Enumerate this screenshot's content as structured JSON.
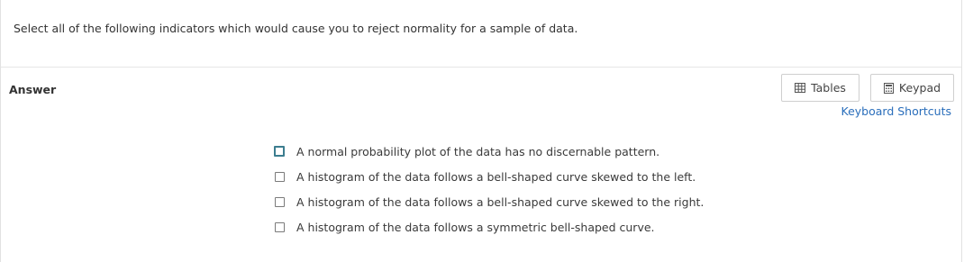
{
  "question": {
    "text": "Select all of the following indicators which would cause you to reject normality for a sample of data."
  },
  "answer": {
    "label": "Answer"
  },
  "toolbar": {
    "tables_label": "Tables",
    "tables_icon": "table-grid-icon",
    "keypad_label": "Keypad",
    "keypad_icon": "calculator-icon",
    "shortcuts_label": "Keyboard Shortcuts"
  },
  "options": [
    {
      "label": "A normal probability plot of the data has no discernable pattern.",
      "checked": false,
      "focused": true
    },
    {
      "label": "A histogram of the data follows a bell-shaped curve skewed to the left.",
      "checked": false,
      "focused": false
    },
    {
      "label": "A histogram of the data follows a bell-shaped curve skewed to the right.",
      "checked": false,
      "focused": false
    },
    {
      "label": "A histogram of the data follows a symmetric bell-shaped curve.",
      "checked": false,
      "focused": false
    }
  ],
  "colors": {
    "link": "#2a6ebb",
    "focus_border": "#3c7d8f"
  }
}
